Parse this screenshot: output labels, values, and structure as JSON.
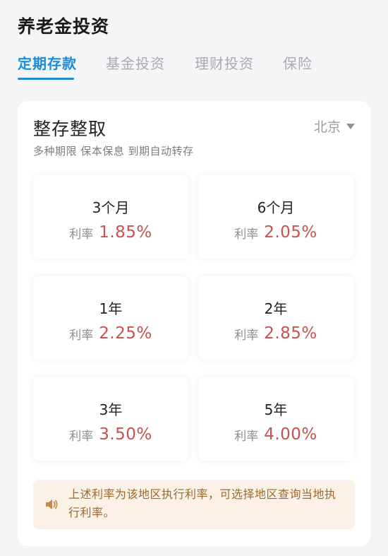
{
  "app": {
    "title": "养老金投资"
  },
  "tabs": [
    {
      "label": "定期存款",
      "active": true
    },
    {
      "label": "基金投资",
      "active": false
    },
    {
      "label": "理财投资",
      "active": false
    },
    {
      "label": "保险",
      "active": false
    }
  ],
  "card": {
    "title": "整存整取",
    "subtitle": "多种期限 保本保息 到期自动转存",
    "region": "北京"
  },
  "rate_label": "利率",
  "rates": [
    {
      "term": "3个月",
      "rate": "1.85%"
    },
    {
      "term": "6个月",
      "rate": "2.05%"
    },
    {
      "term": "1年",
      "rate": "2.25%"
    },
    {
      "term": "2年",
      "rate": "2.85%"
    },
    {
      "term": "3年",
      "rate": "3.50%"
    },
    {
      "term": "5年",
      "rate": "4.00%"
    }
  ],
  "notice": {
    "icon": "speaker-icon",
    "text": "上述利率为该地区执行利率，可选择地区查询当地执行利率。"
  },
  "colors": {
    "accent": "#1f8ad6",
    "rate": "#c95151",
    "notice_bg": "#fbf1e6",
    "notice_text": "#9c6a2c"
  }
}
